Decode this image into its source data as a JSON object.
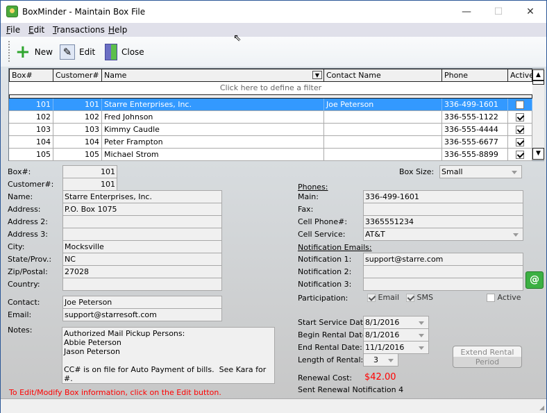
{
  "window": {
    "title": "BoxMinder - Maintain Box File",
    "minimize": "—",
    "maximize": "☐",
    "close": "✕"
  },
  "menu": [
    "File",
    "Edit",
    "Transactions",
    "Help"
  ],
  "toolbar": {
    "new": "New",
    "edit": "Edit",
    "close": "Close"
  },
  "grid": {
    "headers": [
      "Box#",
      "Customer#",
      "Name",
      "Contact Name",
      "Phone",
      "Active"
    ],
    "filter_text": "Click here to define a filter",
    "rows": [
      {
        "box": "101",
        "customer": "101",
        "name": "Starre Enterprises, Inc.",
        "contact": "Joe Peterson",
        "phone": "336-499-1601",
        "active": false,
        "selected": true
      },
      {
        "box": "102",
        "customer": "102",
        "name": "Fred Johnson",
        "contact": "",
        "phone": "336-555-1122",
        "active": true
      },
      {
        "box": "103",
        "customer": "103",
        "name": "Kimmy Caudle",
        "contact": "",
        "phone": "336-555-4444",
        "active": true
      },
      {
        "box": "104",
        "customer": "104",
        "name": "Peter Frampton",
        "contact": "",
        "phone": "336-555-6677",
        "active": true
      },
      {
        "box": "105",
        "customer": "105",
        "name": "Michael Strom",
        "contact": "",
        "phone": "336-555-8899",
        "active": true
      }
    ]
  },
  "form": {
    "labels": {
      "box": "Box#:",
      "customer": "Customer#:",
      "name": "Name:",
      "address": "Address:",
      "address2": "Address 2:",
      "address3": "Address 3:",
      "city": "City:",
      "state": "State/Prov.:",
      "zip": "Zip/Postal:",
      "country": "Country:",
      "contact": "Contact:",
      "email": "Email:",
      "notes": "Notes:"
    },
    "values": {
      "box": "101",
      "customer": "101",
      "name": "Starre Enterprises, Inc.",
      "address": "P.O. Box 1075",
      "address2": "",
      "address3": "",
      "city": "Mocksville",
      "state": "NC",
      "zip": "27028",
      "country": "",
      "contact": "Joe Peterson",
      "email": "support@starresoft.com",
      "notes": "Authorized Mail Pickup Persons:\nAbbie Peterson\nJason Peterson\n\nCC# is on file for Auto Payment of bills.  See Kara for #."
    },
    "hint": "To Edit/Modify Box information, click on the Edit button.",
    "right": {
      "box_size_label": "Box Size:",
      "box_size": "Small",
      "phones_heading": "Phones:",
      "main_label": "Main:",
      "main": "336-499-1601",
      "fax_label": "Fax:",
      "fax": "",
      "cell_label": "Cell Phone#:",
      "cell": "3365551234",
      "cell_service_label": "Cell Service:",
      "cell_service": "AT&T",
      "notif_heading": "Notification Emails:",
      "n1_label": "Notification 1:",
      "n1": "support@starre.com",
      "n2_label": "Notification 2:",
      "n2": "",
      "n3_label": "Notification 3:",
      "n3": "",
      "participation_label": "Participation:",
      "email_opt": "Email",
      "email_checked": true,
      "sms_opt": "SMS",
      "sms_checked": true,
      "active_opt": "Active",
      "active_checked": false,
      "start_label": "Start Service Date:",
      "start": "8/1/2016",
      "begin_label": "Begin Rental Date:",
      "begin": "8/1/2016",
      "end_label": "End Rental Date:",
      "end": "11/1/2016",
      "length_label": "Length of Rental:",
      "length": "3",
      "extend_button": "Extend Rental Period",
      "renewal_label": "Renewal Cost:",
      "renewal": "$42.00",
      "renewal_color": "#ff0000",
      "sent": "Sent Renewal Notification 4"
    }
  }
}
